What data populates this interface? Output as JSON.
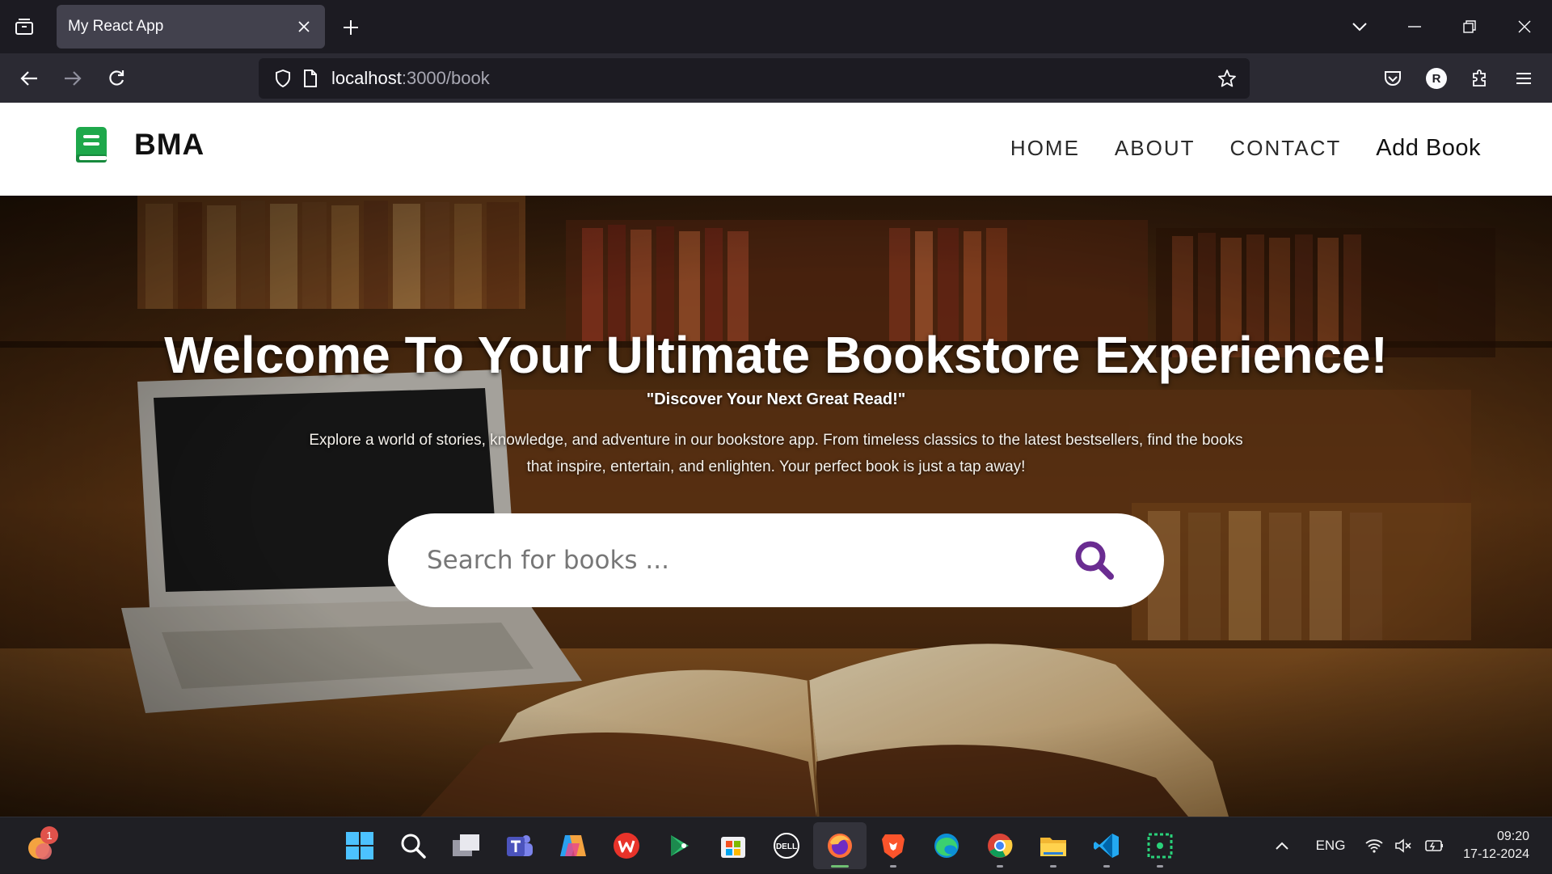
{
  "browser": {
    "tab_title": "My React App",
    "url_host": "localhost",
    "url_rest": ":3000/book",
    "profile_initial": "R"
  },
  "header": {
    "brand": "BMA",
    "nav": {
      "home": "HOME",
      "about": "ABOUT",
      "contact": "CONTACT",
      "add_book": "Add Book"
    }
  },
  "hero": {
    "title": "Welcome To Your Ultimate Bookstore Experience!",
    "subtitle": "\"Discover Your Next Great Read!\"",
    "description": "Explore a world of stories, knowledge, and adventure in our bookstore app. From timeless classics to the latest bestsellers, find the books that inspire, entertain, and enlighten. Your perfect book is just a tap away!",
    "search_placeholder": "Search for books ..."
  },
  "taskbar": {
    "widget_badge": "1",
    "apps": [
      "windows-start-icon",
      "search-icon",
      "task-view-icon",
      "teams-icon",
      "copilot-icon",
      "wps-icon",
      "google-play-games-icon",
      "microsoft-store-icon",
      "dell-icon",
      "firefox-icon",
      "brave-icon",
      "edge-icon",
      "chrome-icon",
      "file-explorer-icon",
      "vscode-icon",
      "snipping-tool-icon"
    ],
    "language": "ENG",
    "time": "09:20",
    "date": "17-12-2024"
  },
  "colors": {
    "brand_green": "#1ea84b",
    "search_icon": "#6a2c91",
    "browser_bg": "#1c1b22",
    "toolbar_bg": "#2b2a33"
  }
}
